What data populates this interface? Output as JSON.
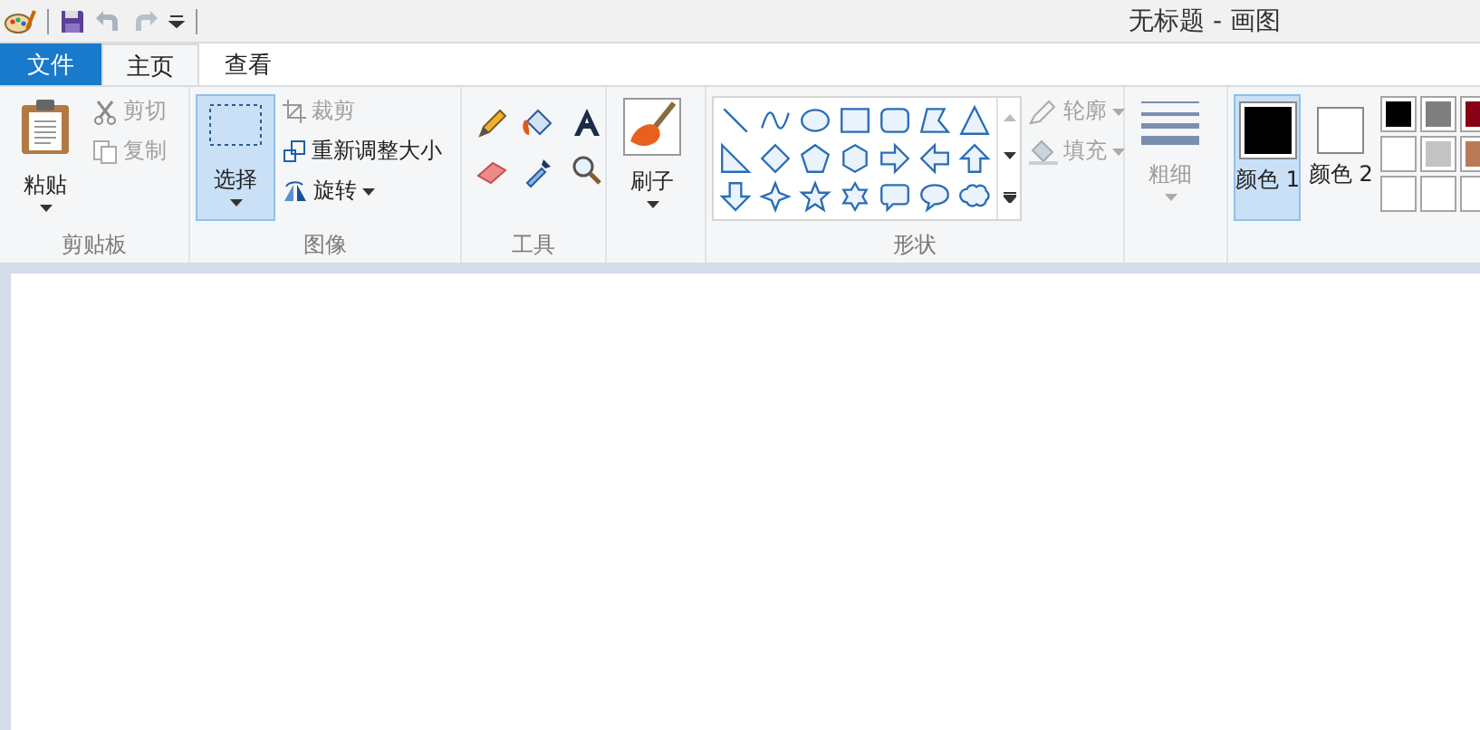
{
  "window": {
    "title": "无标题 - 画图"
  },
  "file_menu": {
    "label": "文件"
  },
  "tabs": [
    {
      "label": "主页",
      "selected": true
    },
    {
      "label": "查看",
      "selected": false
    }
  ],
  "clipboard": {
    "label": "剪贴板",
    "paste": "粘贴",
    "cut": {
      "label": "剪切",
      "disabled": true
    },
    "copy": {
      "label": "复制",
      "disabled": true
    }
  },
  "image": {
    "label": "图像",
    "select": {
      "label": "选择",
      "selected": true
    },
    "crop": {
      "label": "裁剪",
      "disabled": true
    },
    "resize": {
      "label": "重新调整大小",
      "disabled": false
    },
    "rotate": {
      "label": "旋转",
      "disabled": false
    }
  },
  "tools": {
    "label": "工具"
  },
  "brushes": {
    "label": "刷子"
  },
  "shapes": {
    "label": "形状",
    "outline": {
      "label": "轮廓",
      "disabled": true
    },
    "fill": {
      "label": "填充",
      "disabled": true
    }
  },
  "size": {
    "label": "粗细",
    "disabled": true
  },
  "colors": {
    "color1": {
      "label": "颜色 1",
      "selected": true,
      "color": "#000000"
    },
    "color2": {
      "label": "颜色 2",
      "selected": false,
      "color": "#ffffff"
    },
    "palette": [
      {
        "kind": "swatch",
        "color": "#000000"
      },
      {
        "kind": "swatch",
        "color": "#7f7f7f"
      },
      {
        "kind": "swatch",
        "color": "#880015"
      },
      {
        "kind": "swatch",
        "color": "#ffffff"
      },
      {
        "kind": "swatch",
        "color": "#c3c3c3"
      },
      {
        "kind": "swatch",
        "color": "#b97a57"
      },
      {
        "kind": "empty"
      },
      {
        "kind": "empty"
      },
      {
        "kind": "empty"
      }
    ]
  }
}
